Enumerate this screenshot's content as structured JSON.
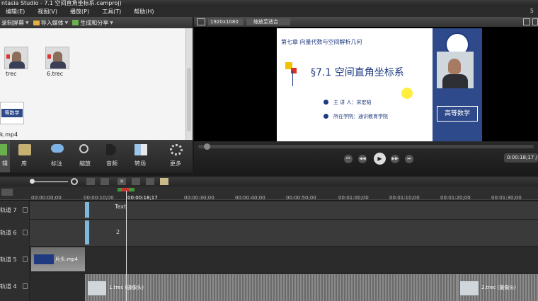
{
  "window": {
    "title": "ntasia Studio - 7.1 空间直角坐标系.camproj)"
  },
  "menubar": {
    "items": [
      "编辑(E)",
      "视图(V)",
      "播放(P)",
      "工具(T)",
      "帮助(H)"
    ],
    "right": "5"
  },
  "left_toolbar": {
    "record": "录制屏幕",
    "import": "导入媒体",
    "produce": "生成和分享"
  },
  "clip_bin": {
    "clips": [
      {
        "label": "trec"
      },
      {
        "label": "6.trec"
      },
      {
        "label": "k.mp4"
      }
    ],
    "title_card_text": "等数学"
  },
  "tabs": [
    {
      "label": "辑"
    },
    {
      "label": "库"
    },
    {
      "label": "标注"
    },
    {
      "label": "缩放"
    },
    {
      "label": "音频"
    },
    {
      "label": "转场"
    },
    {
      "label": "更多"
    }
  ],
  "preview": {
    "resolution": "1920x1080",
    "zoom": "缩放至适合",
    "slide": {
      "chapter": "第七章 向量代数与空间解析几何",
      "heading": "§7.1 空间直角坐标系",
      "speaker": "主 讲 人：宋宏韬",
      "college": "所在学院：通识教育学院",
      "badge": "高等数学"
    },
    "time": "0:00:18;17 / 0"
  },
  "timeline": {
    "ruler": [
      "00:00:00;00",
      "00:00:10;00",
      "00:00:18;17",
      "00:00:30;00",
      "00:00:40;00",
      "00:00:50;00",
      "00:01:00;00",
      "00:01:10;00",
      "00:01:20;00",
      "00:01:30;00"
    ],
    "tracks": [
      {
        "name": "轨道 7",
        "clip": "Text"
      },
      {
        "name": "轨道 6",
        "clip": "2"
      },
      {
        "name": "轨道 5",
        "clip": "片头.mp4"
      },
      {
        "name": "轨道 4",
        "clip": "1.trec (摄像头)",
        "clip2": "2.trec (摄像头)"
      }
    ]
  }
}
